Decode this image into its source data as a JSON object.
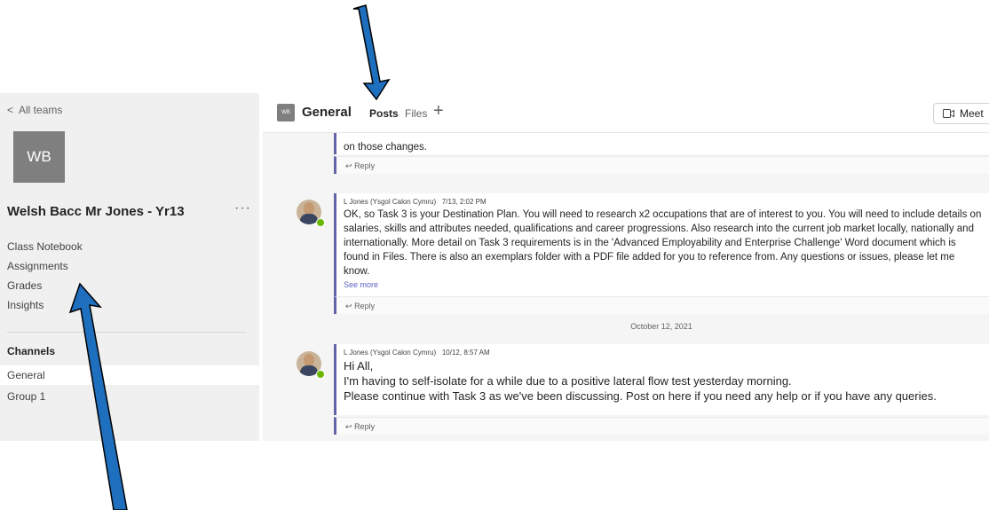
{
  "sidebar": {
    "back_label": "All teams",
    "team_initials": "WB",
    "team_name": "Welsh Bacc Mr Jones - Yr13",
    "more": "···",
    "nav": [
      "Class Notebook",
      "Assignments",
      "Grades",
      "Insights"
    ],
    "channels_heading": "Channels",
    "channels": [
      "General",
      "Group 1"
    ]
  },
  "header": {
    "team_badge": "WB",
    "channel_title": "General",
    "tabs": [
      "Posts",
      "Files"
    ],
    "add_tab": "+",
    "meet_label": "Meet"
  },
  "posts": {
    "partial_text": "on those changes.",
    "reply_label": "Reply",
    "post1": {
      "author": "L Jones (Ysgol Calon Cymru)",
      "time": "7/13, 2:02 PM",
      "lines": [
        "OK, so Task 3 is your Destination Plan. You will need to research x2 occupations that are of interest to you. You will need to include details on",
        "salaries, skills and attributes needed, qualifications and career progressions. Also research into the current job market locally, nationally and",
        "internationally. More detail on Task 3 requirements is in the 'Advanced Employability and Enterprise Challenge' Word document which is",
        "found in Files. There is also an exemplars folder with a PDF file added for you to reference from. Any questions or issues, please let me know."
      ],
      "see_more": "See more"
    },
    "date_separator": "October 12, 2021",
    "post2": {
      "author": "L Jones (Ysgol Calon Cymru)",
      "time": "10/12, 8:57 AM",
      "lines": [
        "Hi All,",
        "I'm having to self-isolate for a while due to a positive lateral flow test yesterday morning.",
        "Please continue with Task 3 as we've been discussing. Post on here if you need any help or if you have any queries."
      ]
    }
  },
  "colors": {
    "accent": "#6264a7",
    "arrow": "#1f6fbf",
    "sidebar_bg": "#f0f0f0",
    "presence": "#6bb700"
  }
}
